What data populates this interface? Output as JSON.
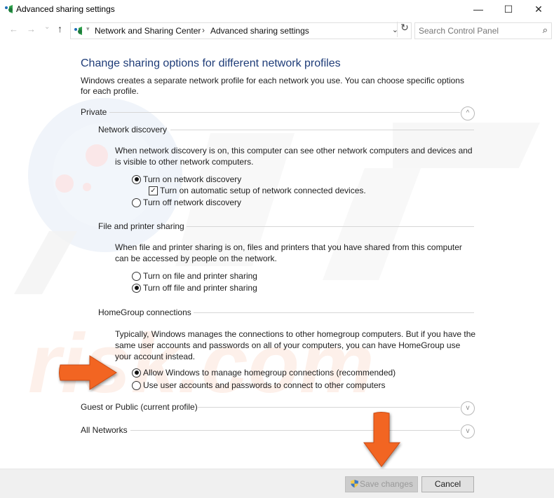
{
  "window": {
    "title": "Advanced sharing settings",
    "controls": {
      "minimize": "—",
      "maximize": "☐",
      "close": "✕"
    }
  },
  "address_bar": {
    "back_icon": "←",
    "forward_icon": "→",
    "recent_icon": "⌄",
    "up_icon": "↑",
    "breadcrumbs": [
      "Network and Sharing Center",
      "Advanced sharing settings"
    ],
    "separator": "›",
    "dropdown_icon": "⌄",
    "refresh_icon": "↻"
  },
  "search": {
    "placeholder": "Search Control Panel",
    "icon": "⌕"
  },
  "main": {
    "heading": "Change sharing options for different network profiles",
    "intro": "Windows creates a separate network profile for each network you use. You can choose specific options for each profile.",
    "profiles": [
      {
        "label": "Private",
        "expanded": true,
        "toggle_icon": "^",
        "sections": [
          {
            "title": "Network discovery",
            "description": "When network discovery is on, this computer can see other network computers and devices and is visible to other network computers.",
            "options": [
              {
                "type": "radio",
                "label": "Turn on network discovery",
                "selected": true
              },
              {
                "type": "checkbox",
                "label": "Turn on automatic setup of network connected devices.",
                "checked": true
              },
              {
                "type": "radio",
                "label": "Turn off network discovery",
                "selected": false
              }
            ]
          },
          {
            "title": "File and printer sharing",
            "description": "When file and printer sharing is on, files and printers that you have shared from this computer can be accessed by people on the network.",
            "options": [
              {
                "type": "radio",
                "label": "Turn on file and printer sharing",
                "selected": false
              },
              {
                "type": "radio",
                "label": "Turn off file and printer sharing",
                "selected": true
              }
            ]
          },
          {
            "title": "HomeGroup connections",
            "description": "Typically, Windows manages the connections to other homegroup computers. But if you have the same user accounts and passwords on all of your computers, you can have HomeGroup use your account instead.",
            "options": [
              {
                "type": "radio",
                "label": "Allow Windows to manage homegroup connections (recommended)",
                "selected": true
              },
              {
                "type": "radio",
                "label": "Use user accounts and passwords to connect to other computers",
                "selected": false
              }
            ]
          }
        ]
      },
      {
        "label": "Guest or Public (current profile)",
        "expanded": false,
        "toggle_icon": "v"
      },
      {
        "label": "All Networks",
        "expanded": false,
        "toggle_icon": "v"
      }
    ]
  },
  "footer": {
    "save_label": "Save changes",
    "save_enabled": false,
    "cancel_label": "Cancel"
  },
  "annotations": {
    "arrow_color": "#f26522"
  }
}
